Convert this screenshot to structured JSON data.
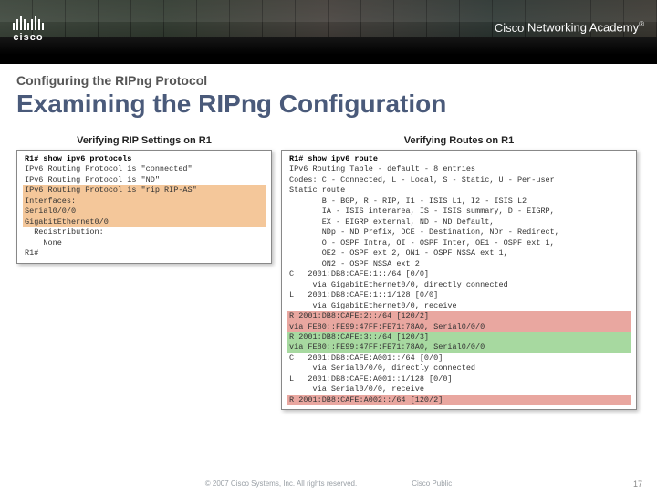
{
  "header": {
    "logo_text": "cisco",
    "academy_html": "Cisco Networking Academy"
  },
  "subtitle": "Configuring the RIPng Protocol",
  "title": "Examining the RIPng Configuration",
  "left": {
    "caption": "Verifying RIP Settings on R1",
    "lines": [
      {
        "t": "R1# show ipv6 protocols",
        "cls": "bold"
      },
      {
        "t": "IPv6 Routing Protocol is \"connected\""
      },
      {
        "t": "IPv6 Routing Protocol is \"ND\""
      },
      {
        "t": "IPv6 Routing Protocol is \"rip RIP-AS\"",
        "hl": "orange"
      },
      {
        "t": "  Interfaces:",
        "hl": "orange"
      },
      {
        "t": "    Serial0/0/0",
        "hl": "orange"
      },
      {
        "t": "    GigabitEthernet0/0",
        "hl": "orange"
      },
      {
        "t": "  Redistribution:"
      },
      {
        "t": "    None"
      },
      {
        "t": "R1#"
      }
    ]
  },
  "right": {
    "caption": "Verifying Routes on R1",
    "lines": [
      {
        "t": "R1# show ipv6 route",
        "cls": "bold"
      },
      {
        "t": "IPv6 Routing Table - default - 8 entries"
      },
      {
        "t": "Codes: C - Connected, L - Local, S - Static, U - Per-user"
      },
      {
        "t": "Static route"
      },
      {
        "t": "       B - BGP, R - RIP, I1 - ISIS L1, I2 - ISIS L2"
      },
      {
        "t": "       IA - ISIS interarea, IS - ISIS summary, D - EIGRP,"
      },
      {
        "t": "       EX - EIGRP external, ND - ND Default,"
      },
      {
        "t": "       NDp - ND Prefix, DCE - Destination, NDr - Redirect,"
      },
      {
        "t": "       O - OSPF Intra, OI - OSPF Inter, OE1 - OSPF ext 1,"
      },
      {
        "t": "       OE2 - OSPF ext 2, ON1 - OSPF NSSA ext 1,"
      },
      {
        "t": "       ON2 - OSPF NSSA ext 2"
      },
      {
        "t": "C   2001:DB8:CAFE:1::/64 [0/0]"
      },
      {
        "t": "     via GigabitEthernet0/0, directly connected"
      },
      {
        "t": "L   2001:DB8:CAFE:1::1/128 [0/0]"
      },
      {
        "t": "     via GigabitEthernet0/0, receive"
      },
      {
        "t": "R   2001:DB8:CAFE:2::/64 [120/2]",
        "hl": "red"
      },
      {
        "t": "     via FE80::FE99:47FF:FE71:78A0, Serial0/0/0",
        "hl": "red"
      },
      {
        "t": "R   2001:DB8:CAFE:3::/64 [120/3]",
        "hl": "green"
      },
      {
        "t": "     via FE80::FE99:47FF:FE71:78A0, Serial0/0/0",
        "hl": "green"
      },
      {
        "t": "C   2001:DB8:CAFE:A001::/64 [0/0]"
      },
      {
        "t": "     via Serial0/0/0, directly connected"
      },
      {
        "t": "L   2001:DB8:CAFE:A001::1/128 [0/0]"
      },
      {
        "t": "     via Serial0/0/0, receive"
      },
      {
        "t": "R   2001:DB8:CAFE:A002::/64 [120/2]",
        "hl": "red"
      }
    ]
  },
  "footer": {
    "copyright": "© 2007 Cisco Systems, Inc. All rights reserved.",
    "classification": "Cisco Public",
    "page": "17"
  }
}
